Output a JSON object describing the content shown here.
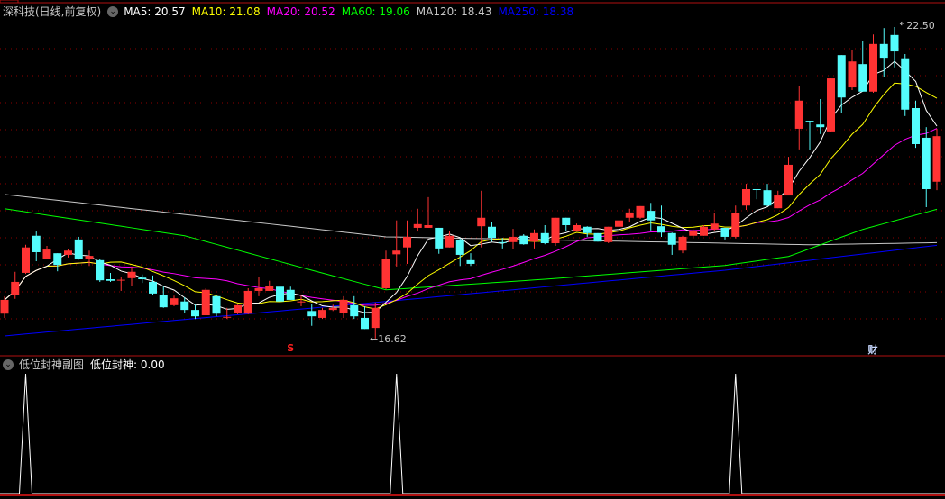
{
  "header": {
    "title": "深科技(日线,前复权)",
    "ma": [
      {
        "label": "MA5: 20.57",
        "color": "#ffffff"
      },
      {
        "label": "MA10: 21.08",
        "color": "#ffff00"
      },
      {
        "label": "MA20: 20.52",
        "color": "#ff00ff"
      },
      {
        "label": "MA60: 19.06",
        "color": "#00ff00"
      },
      {
        "label": "MA120: 18.43",
        "color": "#c8c8c8"
      },
      {
        "label": "MA250: 18.38",
        "color": "#0000ff"
      }
    ]
  },
  "price_labels": {
    "high": "22.50",
    "low": "16.62"
  },
  "signals": [
    {
      "label": "S",
      "index": 27,
      "color": "#ff2020"
    },
    {
      "label": "财",
      "index": 82,
      "color": "#c8d8ff"
    }
  ],
  "sub": {
    "title": "低位封神副图",
    "indicator": "低位封神: 0.00",
    "spikes": [
      2,
      37,
      69
    ]
  },
  "colors": {
    "up": "#ff3333",
    "down": "#54fcfc",
    "grid": "#8b0000",
    "border": "#b01010"
  },
  "chart_data": {
    "type": "candlestick",
    "price_range": [
      16.3,
      22.9
    ],
    "candles": [
      [
        17.09,
        17.35,
        17.42,
        17.01
      ],
      [
        17.45,
        17.69,
        17.88,
        17.37
      ],
      [
        17.86,
        18.34,
        18.39,
        17.84
      ],
      [
        18.56,
        18.25,
        18.64,
        18.08
      ],
      [
        18.13,
        18.3,
        18.37,
        18.13
      ],
      [
        18.23,
        18.01,
        18.23,
        17.89
      ],
      [
        18.2,
        18.28,
        18.3,
        18.15
      ],
      [
        18.49,
        18.13,
        18.54,
        18.11
      ],
      [
        18.13,
        18.18,
        18.28,
        17.99
      ],
      [
        18.1,
        17.72,
        18.13,
        17.69
      ],
      [
        17.74,
        17.71,
        17.86,
        17.69
      ],
      [
        17.72,
        17.73,
        17.79,
        17.52
      ],
      [
        17.76,
        17.88,
        17.98,
        17.62
      ],
      [
        17.77,
        17.74,
        17.83,
        17.67
      ],
      [
        17.69,
        17.47,
        17.81,
        17.45
      ],
      [
        17.45,
        17.21,
        17.6,
        17.2
      ],
      [
        17.25,
        17.38,
        17.43,
        17.23
      ],
      [
        17.32,
        17.16,
        17.4,
        17.11
      ],
      [
        17.16,
        17.04,
        17.26,
        16.99
      ],
      [
        17.06,
        17.54,
        17.57,
        17.06
      ],
      [
        17.42,
        17.09,
        17.45,
        17.04
      ],
      [
        17.02,
        17.03,
        17.2,
        16.99
      ],
      [
        17.11,
        17.25,
        17.26,
        17.08
      ],
      [
        17.09,
        17.52,
        17.57,
        17.08
      ],
      [
        17.52,
        17.57,
        17.79,
        17.42
      ],
      [
        17.52,
        17.62,
        17.71,
        17.52
      ],
      [
        17.6,
        17.32,
        17.67,
        17.18
      ],
      [
        17.54,
        17.35,
        17.6,
        17.35
      ],
      [
        17.31,
        17.32,
        17.43,
        17.23
      ],
      [
        17.14,
        17.04,
        17.28,
        16.86
      ],
      [
        17.01,
        17.16,
        17.2,
        16.99
      ],
      [
        17.16,
        17.2,
        17.26,
        17.14
      ],
      [
        17.11,
        17.35,
        17.42,
        17.01
      ],
      [
        17.25,
        17.04,
        17.42,
        16.99
      ],
      [
        17.01,
        16.8,
        17.23,
        16.8
      ],
      [
        16.82,
        17.2,
        17.3,
        16.62
      ],
      [
        17.57,
        18.13,
        18.28,
        17.55
      ],
      [
        18.21,
        18.28,
        18.85,
        17.98
      ],
      [
        18.34,
        18.54,
        18.85,
        18.03
      ],
      [
        18.71,
        18.78,
        19.07,
        18.64
      ],
      [
        18.71,
        18.76,
        19.29,
        18.71
      ],
      [
        18.71,
        18.32,
        18.71,
        18.22
      ],
      [
        18.34,
        18.56,
        18.64,
        18.34
      ],
      [
        18.49,
        18.2,
        18.51,
        17.99
      ],
      [
        18.1,
        18.03,
        18.23,
        17.99
      ],
      [
        18.74,
        18.9,
        19.41,
        18.34
      ],
      [
        18.73,
        18.52,
        18.81,
        18.45
      ],
      [
        18.44,
        18.43,
        18.52,
        18.32
      ],
      [
        18.44,
        18.54,
        18.69,
        18.3
      ],
      [
        18.56,
        18.4,
        18.59,
        18.39
      ],
      [
        18.45,
        18.61,
        18.68,
        18.32
      ],
      [
        18.61,
        18.42,
        18.76,
        18.4
      ],
      [
        18.42,
        18.9,
        18.9,
        18.37
      ],
      [
        18.9,
        18.76,
        18.9,
        18.64
      ],
      [
        18.64,
        18.76,
        18.79,
        18.64
      ],
      [
        18.73,
        18.61,
        18.74,
        18.54
      ],
      [
        18.61,
        18.45,
        18.61,
        18.45
      ],
      [
        18.44,
        18.73,
        18.73,
        18.42
      ],
      [
        18.73,
        18.85,
        18.88,
        18.71
      ],
      [
        18.9,
        19.0,
        19.07,
        18.81
      ],
      [
        18.9,
        19.12,
        19.12,
        18.88
      ],
      [
        19.03,
        18.85,
        19.18,
        18.66
      ],
      [
        18.74,
        18.62,
        19.13,
        18.54
      ],
      [
        18.61,
        18.39,
        18.62,
        18.2
      ],
      [
        18.28,
        18.54,
        18.56,
        18.23
      ],
      [
        18.56,
        18.66,
        18.68,
        18.51
      ],
      [
        18.56,
        18.73,
        18.76,
        18.56
      ],
      [
        18.68,
        18.79,
        18.99,
        18.66
      ],
      [
        18.71,
        18.54,
        18.71,
        18.49
      ],
      [
        18.54,
        18.99,
        19.13,
        18.51
      ],
      [
        19.13,
        19.44,
        19.54,
        19.05
      ],
      [
        19.44,
        19.43,
        19.44,
        19.25
      ],
      [
        19.42,
        19.13,
        19.54,
        19.12
      ],
      [
        19.08,
        19.32,
        19.41,
        19.08
      ],
      [
        19.32,
        19.9,
        20.05,
        19.32
      ],
      [
        20.58,
        21.11,
        21.38,
        20.19
      ],
      [
        20.73,
        20.72,
        20.73,
        20.17
      ],
      [
        20.66,
        20.61,
        21.14,
        20.48
      ],
      [
        20.53,
        21.53,
        21.53,
        20.51
      ],
      [
        21.97,
        21.17,
        21.97,
        20.87
      ],
      [
        21.36,
        21.85,
        22.07,
        21.31
      ],
      [
        21.8,
        21.28,
        22.24,
        21.28
      ],
      [
        21.28,
        22.18,
        22.36,
        21.26
      ],
      [
        22.18,
        21.92,
        22.48,
        21.55
      ],
      [
        22.35,
        22.04,
        22.5,
        21.74
      ],
      [
        21.91,
        20.94,
        21.99,
        20.82
      ],
      [
        20.97,
        20.29,
        21.11,
        20.22
      ],
      [
        20.41,
        19.44,
        20.61,
        19.1
      ],
      [
        19.58,
        20.44,
        20.58,
        19.42
      ]
    ],
    "ma_long": {
      "ma60": [
        [
          0,
          19.07
        ],
        [
          17,
          18.56
        ],
        [
          29,
          17.91
        ],
        [
          36,
          17.54
        ],
        [
          51,
          17.74
        ],
        [
          68,
          18.0
        ],
        [
          74,
          18.17
        ],
        [
          81,
          18.68
        ],
        [
          88,
          19.06
        ]
      ],
      "ma120": [
        [
          0,
          19.34
        ],
        [
          36,
          18.54
        ],
        [
          76,
          18.39
        ],
        [
          88,
          18.43
        ]
      ],
      "ma250": [
        [
          0,
          16.67
        ],
        [
          17,
          16.98
        ],
        [
          36,
          17.32
        ],
        [
          68,
          17.91
        ],
        [
          88,
          18.38
        ]
      ]
    }
  }
}
